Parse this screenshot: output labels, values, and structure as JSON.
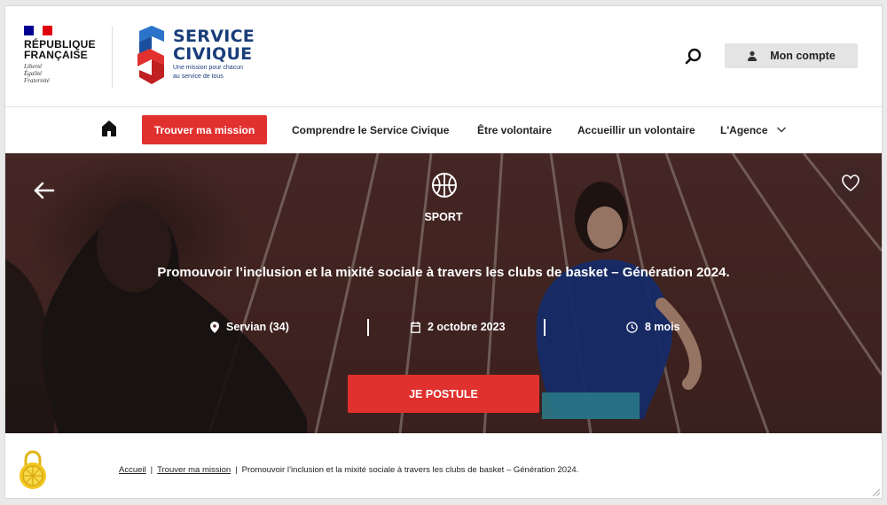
{
  "header": {
    "rf_title_line1": "RÉPUBLIQUE",
    "rf_title_line2": "FRANÇAISE",
    "rf_motto": [
      "Liberté",
      "Égalité",
      "Fraternité"
    ],
    "logo_line1": "SERVICE",
    "logo_line2": "CIVIQUE",
    "logo_tagline_1": "Une mission pour chacun",
    "logo_tagline_2": "au service de tous",
    "search_icon": "search-icon",
    "account_label": "Mon compte",
    "account_icon": "user-icon"
  },
  "nav": {
    "home_icon": "home-icon",
    "cta": "Trouver ma mission",
    "links": [
      "Comprendre le Service Civique",
      "Être volontaire",
      "Accueillir un volontaire",
      "L'Agence"
    ]
  },
  "hero": {
    "category": "SPORT",
    "category_icon": "basketball-icon",
    "title": "Promouvoir l’inclusion et la mixité sociale à travers les clubs de basket – Génération 2024.",
    "location": "Servian (34)",
    "date": "2 octobre 2023",
    "duration": "8 mois",
    "apply": "JE POSTULE"
  },
  "breadcrumb": {
    "items": [
      "Accueil",
      "Trouver ma mission"
    ],
    "current": "Promouvoir l’inclusion et la mixité sociale à travers les clubs de basket – Génération 2024."
  },
  "colors": {
    "accent_red": "#e1312f",
    "brand_blue": "#1a3e7a",
    "flag_blue": "#000091",
    "flag_red": "#e1000f"
  }
}
